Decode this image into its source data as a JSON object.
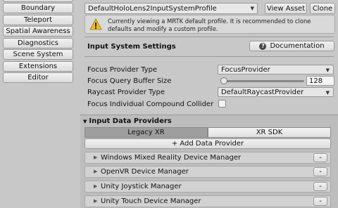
{
  "nav": {
    "items": [
      {
        "label": "Boundary"
      },
      {
        "label": "Teleport"
      },
      {
        "label": "Spatial Awareness"
      },
      {
        "label": "Diagnostics"
      },
      {
        "label": "Scene System"
      },
      {
        "label": "Extensions"
      },
      {
        "label": "Editor"
      }
    ]
  },
  "profile": {
    "selected": "DefaultHoloLens2InputSystemProfile",
    "view_asset_label": "View Asset",
    "clone_label": "Clone"
  },
  "warning": {
    "text": "Currently viewing a MRTK default profile. It is recommended to clone defaults and modify a custom profile."
  },
  "settings": {
    "title": "Input System Settings",
    "documentation_label": "Documentation",
    "focus_provider_type": {
      "label": "Focus Provider Type",
      "value": "FocusProvider"
    },
    "focus_query_buffer_size": {
      "label": "Focus Query Buffer Size",
      "value": "128"
    },
    "raycast_provider_type": {
      "label": "Raycast Provider Type",
      "value": "DefaultRaycastProvider"
    },
    "focus_individual_compound_collider": {
      "label": "Focus Individual Compound Collider",
      "checked": false
    }
  },
  "data_providers": {
    "title": "Input Data Providers",
    "tabs": [
      {
        "label": "Legacy XR",
        "active": true
      },
      {
        "label": "XR SDK",
        "active": false
      }
    ],
    "add_label": "+ Add Data Provider",
    "remove_label": "-",
    "providers": [
      {
        "name": "Windows Mixed Reality Device Manager"
      },
      {
        "name": "OpenVR Device Manager"
      },
      {
        "name": "Unity Joystick Manager"
      },
      {
        "name": "Unity Touch Device Manager"
      }
    ]
  },
  "colors": {
    "warning_icon": "#f0c020",
    "background": "#c8c8c8"
  }
}
